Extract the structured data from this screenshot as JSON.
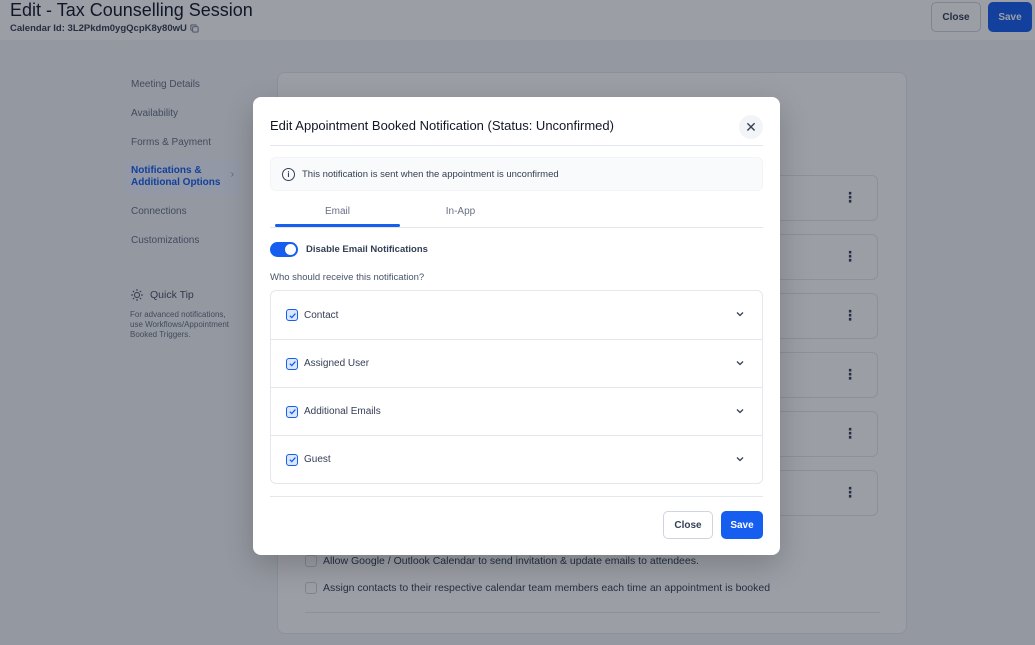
{
  "header": {
    "title": "Edit - Tax Counselling Session",
    "calendar_id": "Calendar Id: 3L2Pkdm0ygQcpK8y80wU",
    "close_label": "Close",
    "save_label": "Save"
  },
  "sidebar": {
    "items": [
      {
        "label": "Meeting Details"
      },
      {
        "label": "Availability"
      },
      {
        "label": "Forms & Payment"
      },
      {
        "label": "Notifications & Additional Options",
        "active": true
      },
      {
        "label": "Connections"
      },
      {
        "label": "Customizations"
      }
    ],
    "quick_tip": {
      "heading": "Quick Tip",
      "text": "For advanced notifications, use Workflows/Appointment Booked Triggers."
    }
  },
  "background_options": {
    "google_outlook": "Allow Google / Outlook Calendar to send invitation & update emails to attendees.",
    "assign_contacts": "Assign contacts to their respective calendar team members each time an appointment is booked"
  },
  "modal": {
    "title": "Edit Appointment Booked Notification (Status: Unconfirmed)",
    "info_text": "This notification is sent when the appointment is unconfirmed",
    "tabs": [
      {
        "label": "Email",
        "active": true
      },
      {
        "label": "In-App",
        "active": false
      }
    ],
    "toggle_label": "Disable Email Notifications",
    "toggle_on": true,
    "recipients_heading": "Who should receive this notification?",
    "recipients": [
      {
        "label": "Contact",
        "checked": true
      },
      {
        "label": "Assigned User",
        "checked": true
      },
      {
        "label": "Additional Emails",
        "checked": true
      },
      {
        "label": "Guest",
        "checked": true
      }
    ],
    "close_label": "Close",
    "save_label": "Save"
  },
  "colors": {
    "accent": "#155eef",
    "overlay": "rgba(16,24,40,0.42)"
  }
}
